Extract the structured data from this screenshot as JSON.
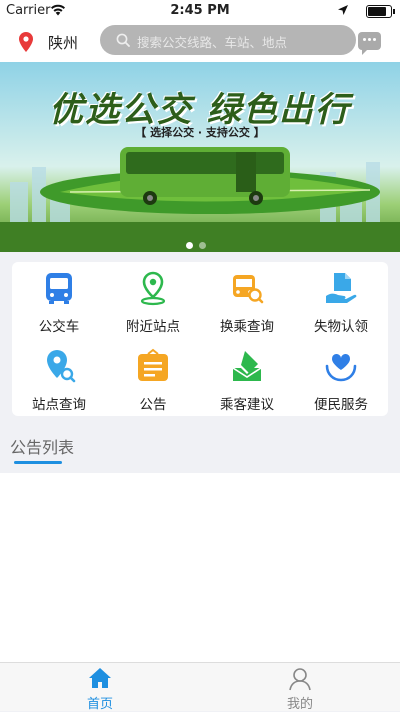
{
  "status_bar": {
    "carrier": "Carrier",
    "time": "2:45 PM"
  },
  "header": {
    "city": "陕州",
    "search_placeholder": "搜索公交线路、车站、地点"
  },
  "banner": {
    "title": "优选公交  绿色出行",
    "subtitle": "【 选择公交 · 支持公交 】",
    "slide_count": 2,
    "active_slide": 1
  },
  "services": [
    {
      "label": "公交车",
      "icon": "bus-icon",
      "color": "#2f7fe6"
    },
    {
      "label": "附近站点",
      "icon": "nearby-location-icon",
      "color": "#2db84d"
    },
    {
      "label": "换乘查询",
      "icon": "transfer-search-icon",
      "color": "#f5a623"
    },
    {
      "label": "失物认领",
      "icon": "lost-found-icon",
      "color": "#3aa8e8"
    },
    {
      "label": "站点查询",
      "icon": "station-search-icon",
      "color": "#3aa8e8"
    },
    {
      "label": "公告",
      "icon": "announcement-icon",
      "color": "#f5a623"
    },
    {
      "label": "乘客建议",
      "icon": "suggestion-icon",
      "color": "#2db84d"
    },
    {
      "label": "便民服务",
      "icon": "convenience-service-icon",
      "color": "#2f7fe6"
    }
  ],
  "notice": {
    "title": "公告列表"
  },
  "tabbar": {
    "active_color": "#1e8fe0",
    "inactive_color": "#888888",
    "tabs": [
      {
        "label": "首页",
        "icon": "home-icon",
        "active": true
      },
      {
        "label": "我的",
        "icon": "profile-icon",
        "active": false
      }
    ]
  }
}
